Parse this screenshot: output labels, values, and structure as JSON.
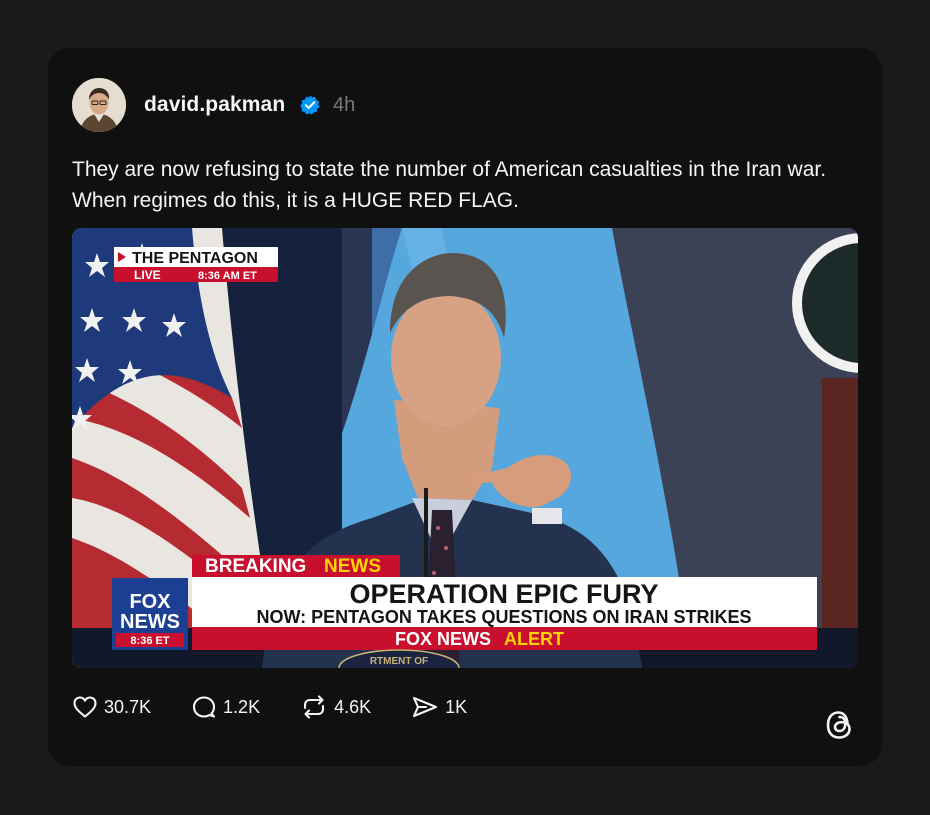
{
  "post": {
    "username": "david.pakman",
    "time": "4h",
    "text": "They are now refusing to state the number of American casualties in the Iran war. When regimes do this, it is a HUGE RED FLAG.",
    "verified_icon": "verified-badge-icon",
    "avatar_icon": "avatar-photo"
  },
  "media": {
    "location_label": "THE PENTAGON",
    "live_label": "LIVE",
    "live_time": "8:36 AM ET",
    "breaking_label_1": "BREAKING",
    "breaking_label_2": "NEWS",
    "headline": "OPERATION EPIC FURY",
    "subheadline": "NOW: PENTAGON TAKES QUESTIONS ON IRAN STRIKES",
    "alert_label_1": "FOX NEWS",
    "alert_label_2": "ALERT",
    "logo_line_1": "FOX",
    "logo_line_2": "NEWS",
    "logo_time": "8:36 ET",
    "seal_text": "RTMENT OF"
  },
  "actions": {
    "likes": "30.7K",
    "replies": "1.2K",
    "reposts": "4.6K",
    "shares": "1K"
  },
  "colors": {
    "background": "#1a1a1a",
    "card": "#101010",
    "text": "#f3f5f7",
    "muted": "#777777",
    "verified": "#0095f6",
    "fox_red": "#c8102e",
    "fox_blue": "#1c3f94"
  },
  "icons": [
    "heart-icon",
    "comment-icon",
    "repost-icon",
    "share-icon",
    "threads-logo-icon"
  ]
}
